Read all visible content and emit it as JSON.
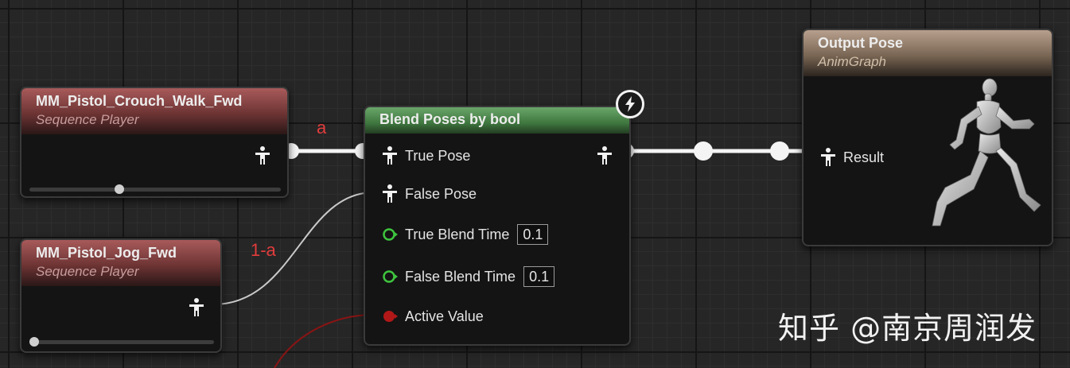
{
  "nodes": {
    "crouch": {
      "title": "MM_Pistol_Crouch_Walk_Fwd",
      "subtitle": "Sequence Player",
      "playback_position": 0.37
    },
    "jog": {
      "title": "MM_Pistol_Jog_Fwd",
      "subtitle": "Sequence Player",
      "playback_position": 0.0
    },
    "blend": {
      "title": "Blend Poses by bool",
      "true_pose": "True Pose",
      "false_pose": "False Pose",
      "true_blend_time_label": "True Blend Time",
      "true_blend_time_value": "0.1",
      "false_blend_time_label": "False Blend Time",
      "false_blend_time_value": "0.1",
      "active_value": "Active Value"
    },
    "output": {
      "title": "Output Pose",
      "subtitle": "AnimGraph",
      "result": "Result"
    }
  },
  "wire_labels": {
    "a": "a",
    "one_minus_a": "1-a"
  },
  "watermark": "知乎 @南京周润发",
  "icons": {
    "pose_pin": "pose-pin-icon",
    "float_pin": "float-pin-icon",
    "bool_pin": "bool-pin-icon",
    "fast_path": "lightning-icon",
    "mannequin": "running-mannequin-icon"
  },
  "colors": {
    "sequence_header": "#8b4444",
    "blend_header": "#4f8a4f",
    "output_header": "#9a8470",
    "float_pin": "#3ec43e",
    "bool_pin": "#b31818",
    "label_red": "#e23c3c"
  }
}
